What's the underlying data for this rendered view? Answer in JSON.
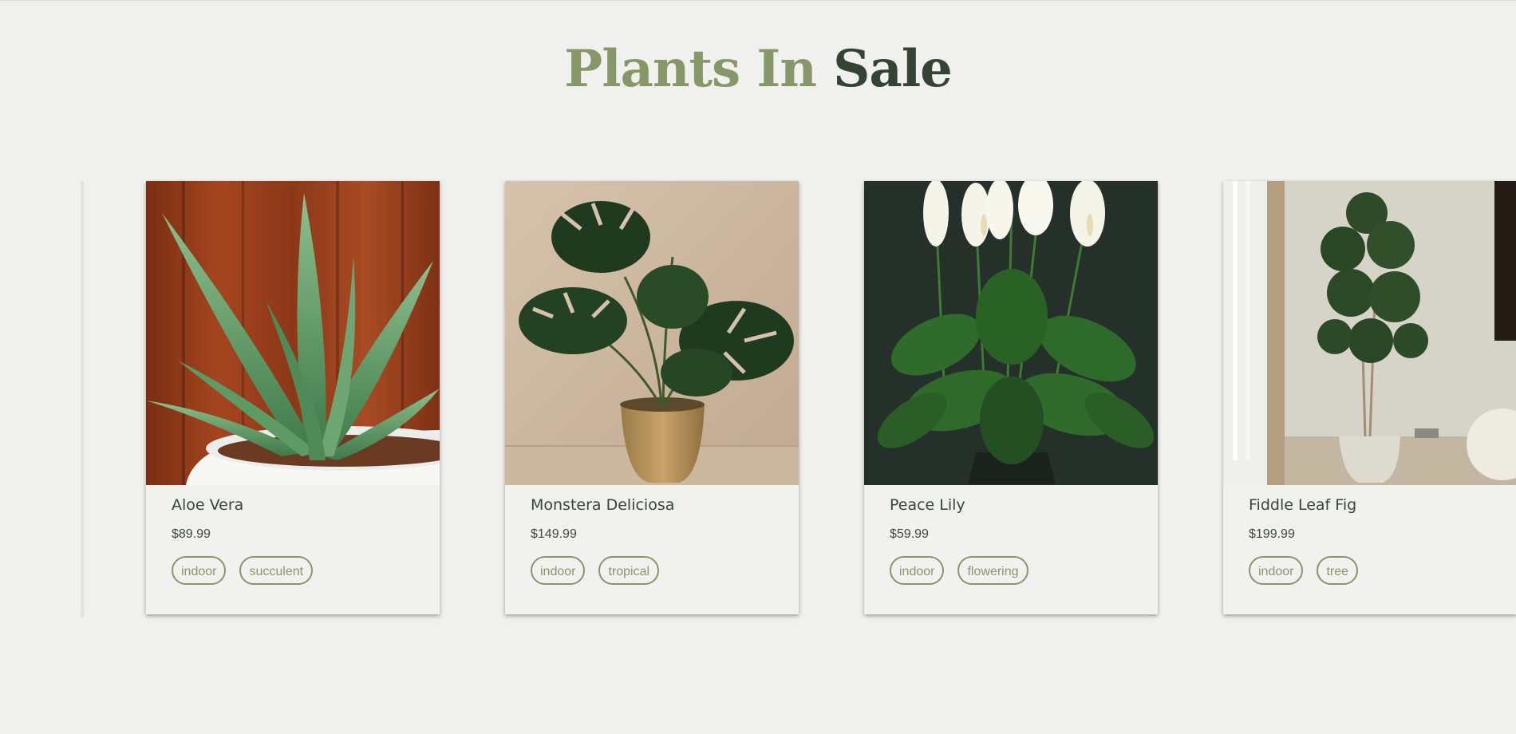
{
  "page": {
    "title_part1": "Plants In",
    "title_part2": "Sale"
  },
  "products": [
    {
      "name": "Aloe Vera",
      "price": "$89.99",
      "tags": [
        "indoor",
        "succulent"
      ],
      "image": "aloe-vera-photo"
    },
    {
      "name": "Monstera Deliciosa",
      "price": "$149.99",
      "tags": [
        "indoor",
        "tropical"
      ],
      "image": "monstera-photo"
    },
    {
      "name": "Peace Lily",
      "price": "$59.99",
      "tags": [
        "indoor",
        "flowering"
      ],
      "image": "peace-lily-photo"
    },
    {
      "name": "Fiddle Leaf Fig",
      "price": "$199.99",
      "tags": [
        "indoor",
        "tree"
      ],
      "image": "fiddle-leaf-fig-photo"
    }
  ],
  "colors": {
    "background": "#f0f0ee",
    "accent_green": "#879868",
    "dark_green": "#344434"
  }
}
